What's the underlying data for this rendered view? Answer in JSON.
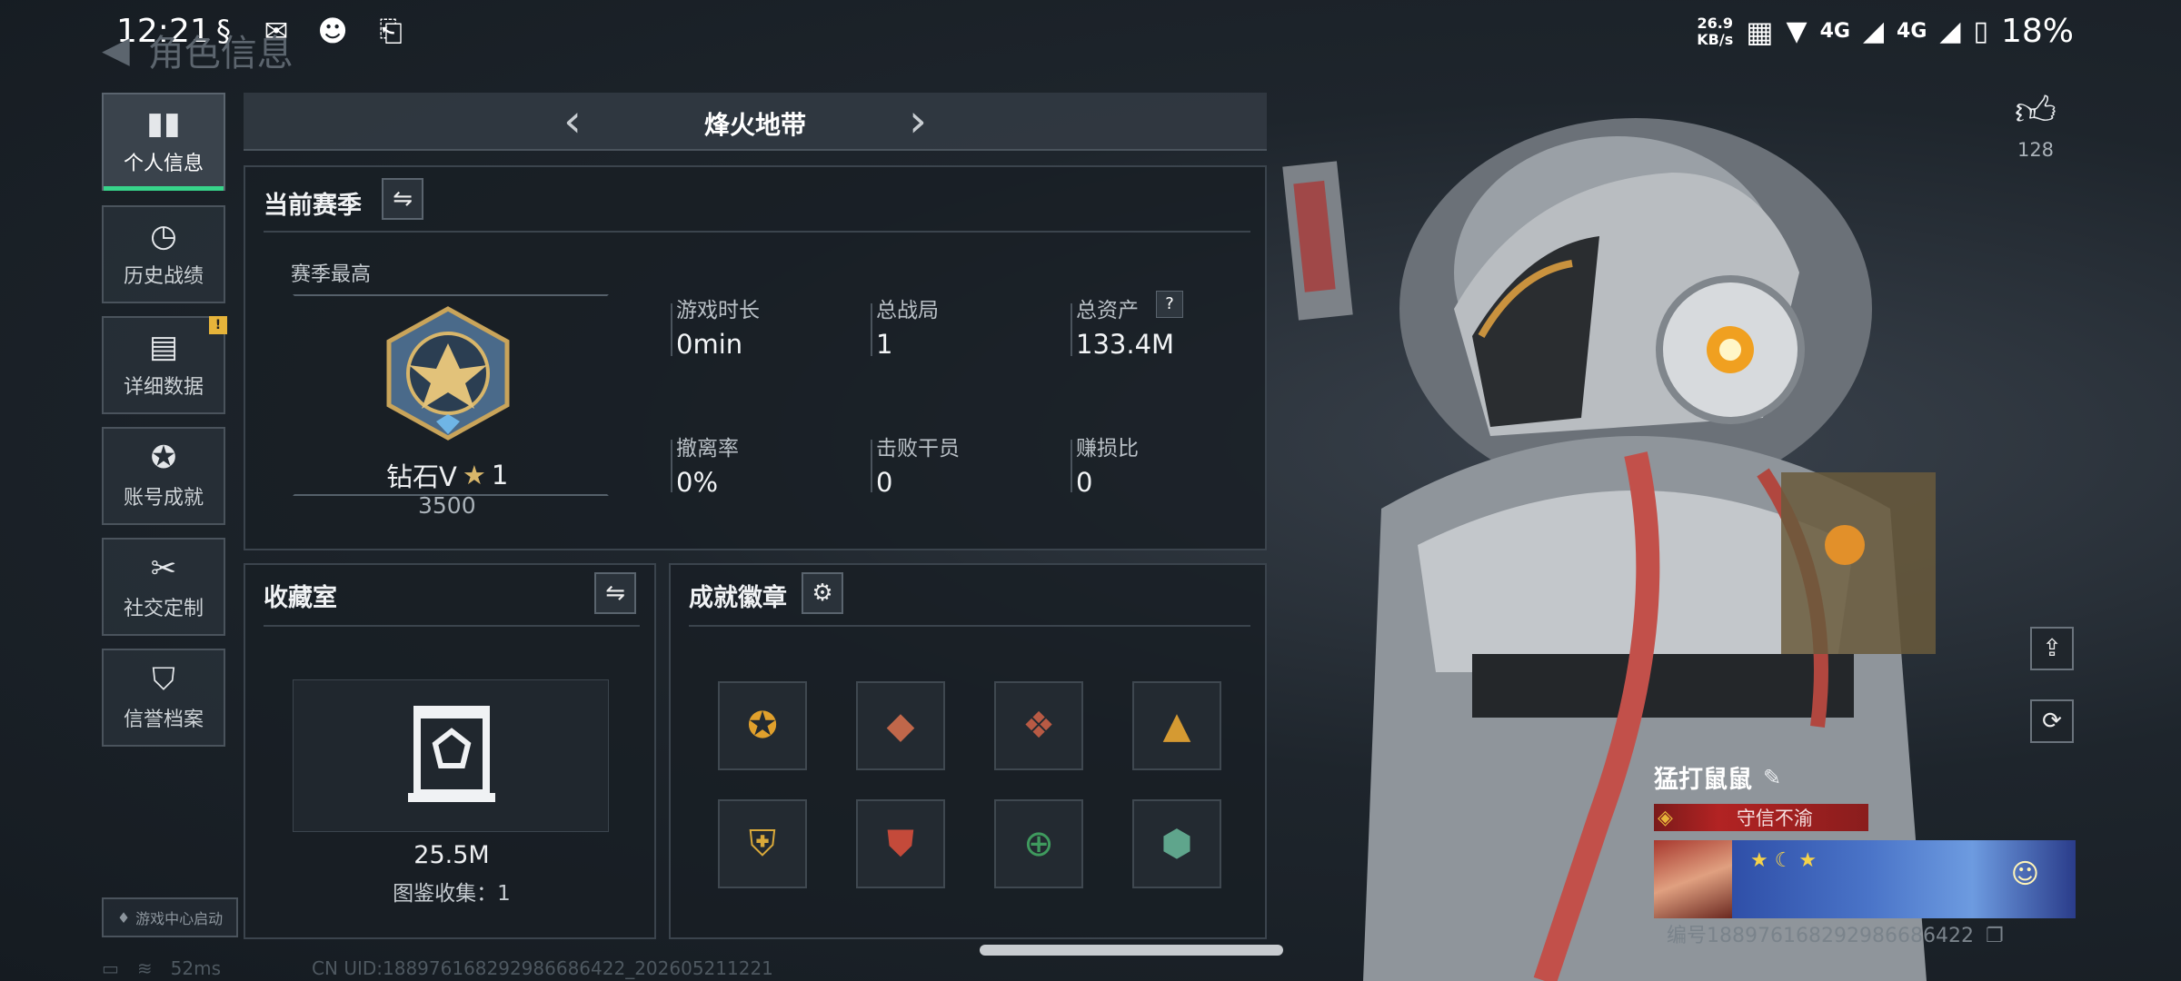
{
  "status_bar": {
    "time": "12:21",
    "net_speed_value": "26.9",
    "net_speed_unit": "KB/s",
    "network_1": "4G",
    "network_2": "4G",
    "battery": "18%"
  },
  "header": {
    "title": "角色信息"
  },
  "nav": {
    "items": [
      {
        "label": "个人信息",
        "icon": "bar-chart-icon",
        "active": true
      },
      {
        "label": "历史战绩",
        "icon": "clock-history-icon"
      },
      {
        "label": "详细数据",
        "icon": "folder-icon",
        "badge": "!"
      },
      {
        "label": "账号成就",
        "icon": "achievement-icon"
      },
      {
        "label": "社交定制",
        "icon": "tools-icon"
      },
      {
        "label": "信誉档案",
        "icon": "shield-icon"
      }
    ],
    "game_center_label": "游戏中心启动"
  },
  "mode_tabs": {
    "current": "烽火地带"
  },
  "season": {
    "title": "当前赛季",
    "best_label": "赛季最高",
    "rank_name": "钻石V",
    "rank_stars": "1",
    "rank_score": "3500",
    "stats": [
      {
        "label": "游戏时长",
        "value": "0min"
      },
      {
        "label": "总战局",
        "value": "1"
      },
      {
        "label": "总资产",
        "value": "133.4M",
        "help": "?"
      },
      {
        "label": "撤离率",
        "value": "0%"
      },
      {
        "label": "击败干员",
        "value": "0"
      },
      {
        "label": "赚损比",
        "value": "0"
      }
    ]
  },
  "collection": {
    "title": "收藏室",
    "value": "25.5M",
    "collected_label": "图鉴收集：1"
  },
  "badges": {
    "title": "成就徽章",
    "items": [
      "star-medal-icon",
      "runner-badge-icon",
      "dragon-badge-icon",
      "pyramid-badge-icon",
      "wing-shield-icon",
      "eagle-crest-icon",
      "crosshair-shield-icon",
      "hornet-badge-icon"
    ]
  },
  "profile": {
    "likes": "128",
    "player_name": "猛打鼠鼠",
    "credit_title": "守信不渝",
    "id_label": "编号1889761682929866864​22"
  },
  "footer": {
    "ping": "52ms",
    "uid_text": "CN UID:18897616829298668642​2_202605211221"
  },
  "colors": {
    "accent": "#37d48a",
    "warning": "#e6b43a",
    "credit_red": "#b22323"
  }
}
